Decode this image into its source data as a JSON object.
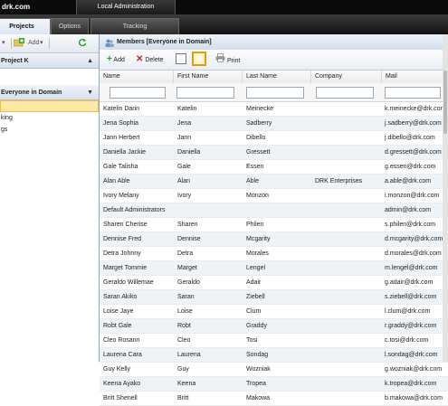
{
  "app": {
    "brand": "drk.com",
    "top_tab": "Local Administration"
  },
  "tabs": [
    {
      "label": "Projects",
      "active": true
    },
    {
      "label": "Options",
      "active": false
    },
    {
      "label": "Tracking",
      "active": false
    }
  ],
  "left_panel": {
    "toolbar": {
      "add_label": "Add",
      "arrow1": "▾",
      "arrow2": "▾"
    },
    "sections": [
      {
        "title": "Project K"
      },
      {
        "title": "Everyone in Domain"
      }
    ],
    "items": [
      "",
      "king",
      "gs"
    ]
  },
  "members": {
    "title": "Members [Everyone in Domain]",
    "toolbar": {
      "add": "Add",
      "delete": "Delete",
      "print": "Print"
    },
    "columns": [
      "Name",
      "First Name",
      "Last Name",
      "Company",
      "Mail"
    ],
    "rows": [
      [
        "Katelin Darin",
        "Katelin",
        "Meinecke",
        "",
        "k.meinecke@drk.com"
      ],
      [
        "Jena Sophia",
        "Jena",
        "Sadberry",
        "",
        "j.sadberry@drk.com"
      ],
      [
        "Jann Herbert",
        "Jann",
        "Dibello",
        "",
        "j.dibello@drk.com"
      ],
      [
        "Daniella Jackie",
        "Daniella",
        "Gressett",
        "",
        "d.gressett@drk.com"
      ],
      [
        "Gale Talisha",
        "Gale",
        "Essen",
        "",
        "g.essen@drk.com"
      ],
      [
        "Alan Able",
        "Alan",
        "Able",
        "DRK Enterprises",
        "a.able@drk.com"
      ],
      [
        "Ivory Melany",
        "Ivory",
        "Monzon",
        "",
        "i.monzon@drk.com"
      ],
      [
        "Default Administrators",
        "",
        "",
        "",
        "admin@drk.com"
      ],
      [
        "Sharen Cherise",
        "Sharen",
        "Philen",
        "",
        "s.philen@drk.com"
      ],
      [
        "Dennise Fred",
        "Dennise",
        "Mcgarity",
        "",
        "d.mcgarity@drk.com"
      ],
      [
        "Detra Johnny",
        "Detra",
        "Morales",
        "",
        "d.morales@drk.com"
      ],
      [
        "Marget Tommie",
        "Marget",
        "Lengel",
        "",
        "m.lengel@drk.com"
      ],
      [
        "Geraldo Willemae",
        "Geraldo",
        "Adair",
        "",
        "g.adair@drk.com"
      ],
      [
        "Saran Akiko",
        "Saran",
        "Ziebell",
        "",
        "s.ziebell@drk.com"
      ],
      [
        "Loise Jaye",
        "Loise",
        "Clum",
        "",
        "l.clum@drk.com"
      ],
      [
        "Robt Gale",
        "Robt",
        "Graddy",
        "",
        "r.graddy@drk.com"
      ],
      [
        "Cleo Rosann",
        "Cleo",
        "Tosi",
        "",
        "c.tosi@drk.com"
      ],
      [
        "Laurena Cara",
        "Laurena",
        "Sondag",
        "",
        "l.sondag@drk.com"
      ],
      [
        "Guy Kelly",
        "Guy",
        "Wozniak",
        "",
        "g.wozniak@drk.com"
      ],
      [
        "Keena Ayako",
        "Keena",
        "Tropea",
        "",
        "k.tropea@drk.com"
      ],
      [
        "Britt Shenell",
        "Britt",
        "Makowa",
        "",
        "b.makowa@drk.com"
      ]
    ]
  }
}
